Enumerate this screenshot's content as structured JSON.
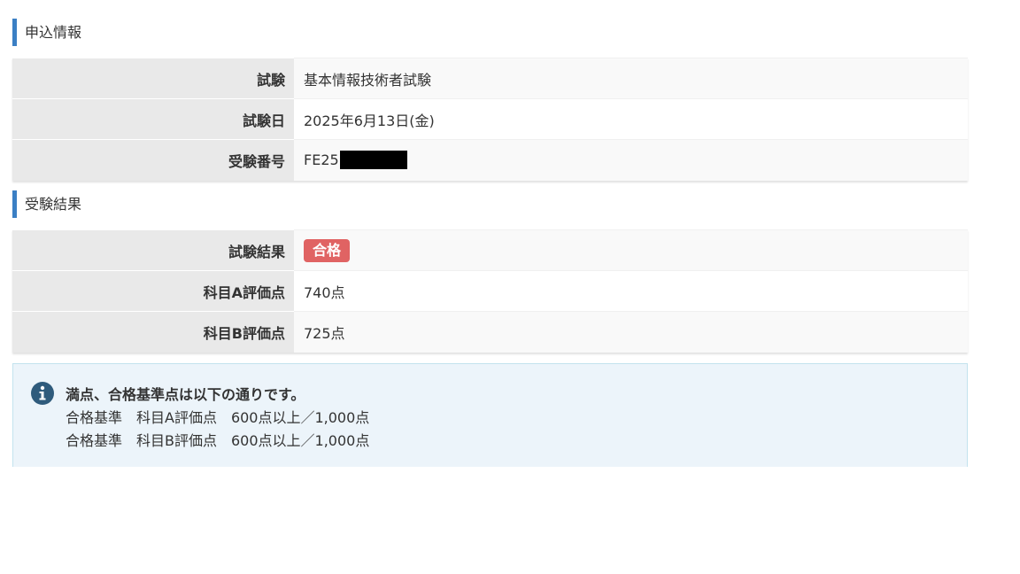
{
  "application_section": {
    "title": "申込情報",
    "rows": [
      {
        "label": "試験",
        "value": "基本情報技術者試験"
      },
      {
        "label": "試験日",
        "value": "2025年6月13日(金)"
      },
      {
        "label": "受験番号",
        "value": "FE25"
      }
    ]
  },
  "result_section": {
    "title": "受験結果",
    "rows": [
      {
        "label": "試験結果",
        "value": "合格"
      },
      {
        "label": "科目A評価点",
        "value": "740点"
      },
      {
        "label": "科目B評価点",
        "value": "725点"
      }
    ],
    "badge_color": "#e06363"
  },
  "notice": {
    "heading": "満点、合格基準点は以下の通りです。",
    "lines": [
      "合格基準　科目A評価点　600点以上／1,000点",
      "合格基準　科目B評価点　600点以上／1,000点"
    ],
    "icon": "info-circle-icon",
    "icon_color": "#2f5b7c"
  }
}
